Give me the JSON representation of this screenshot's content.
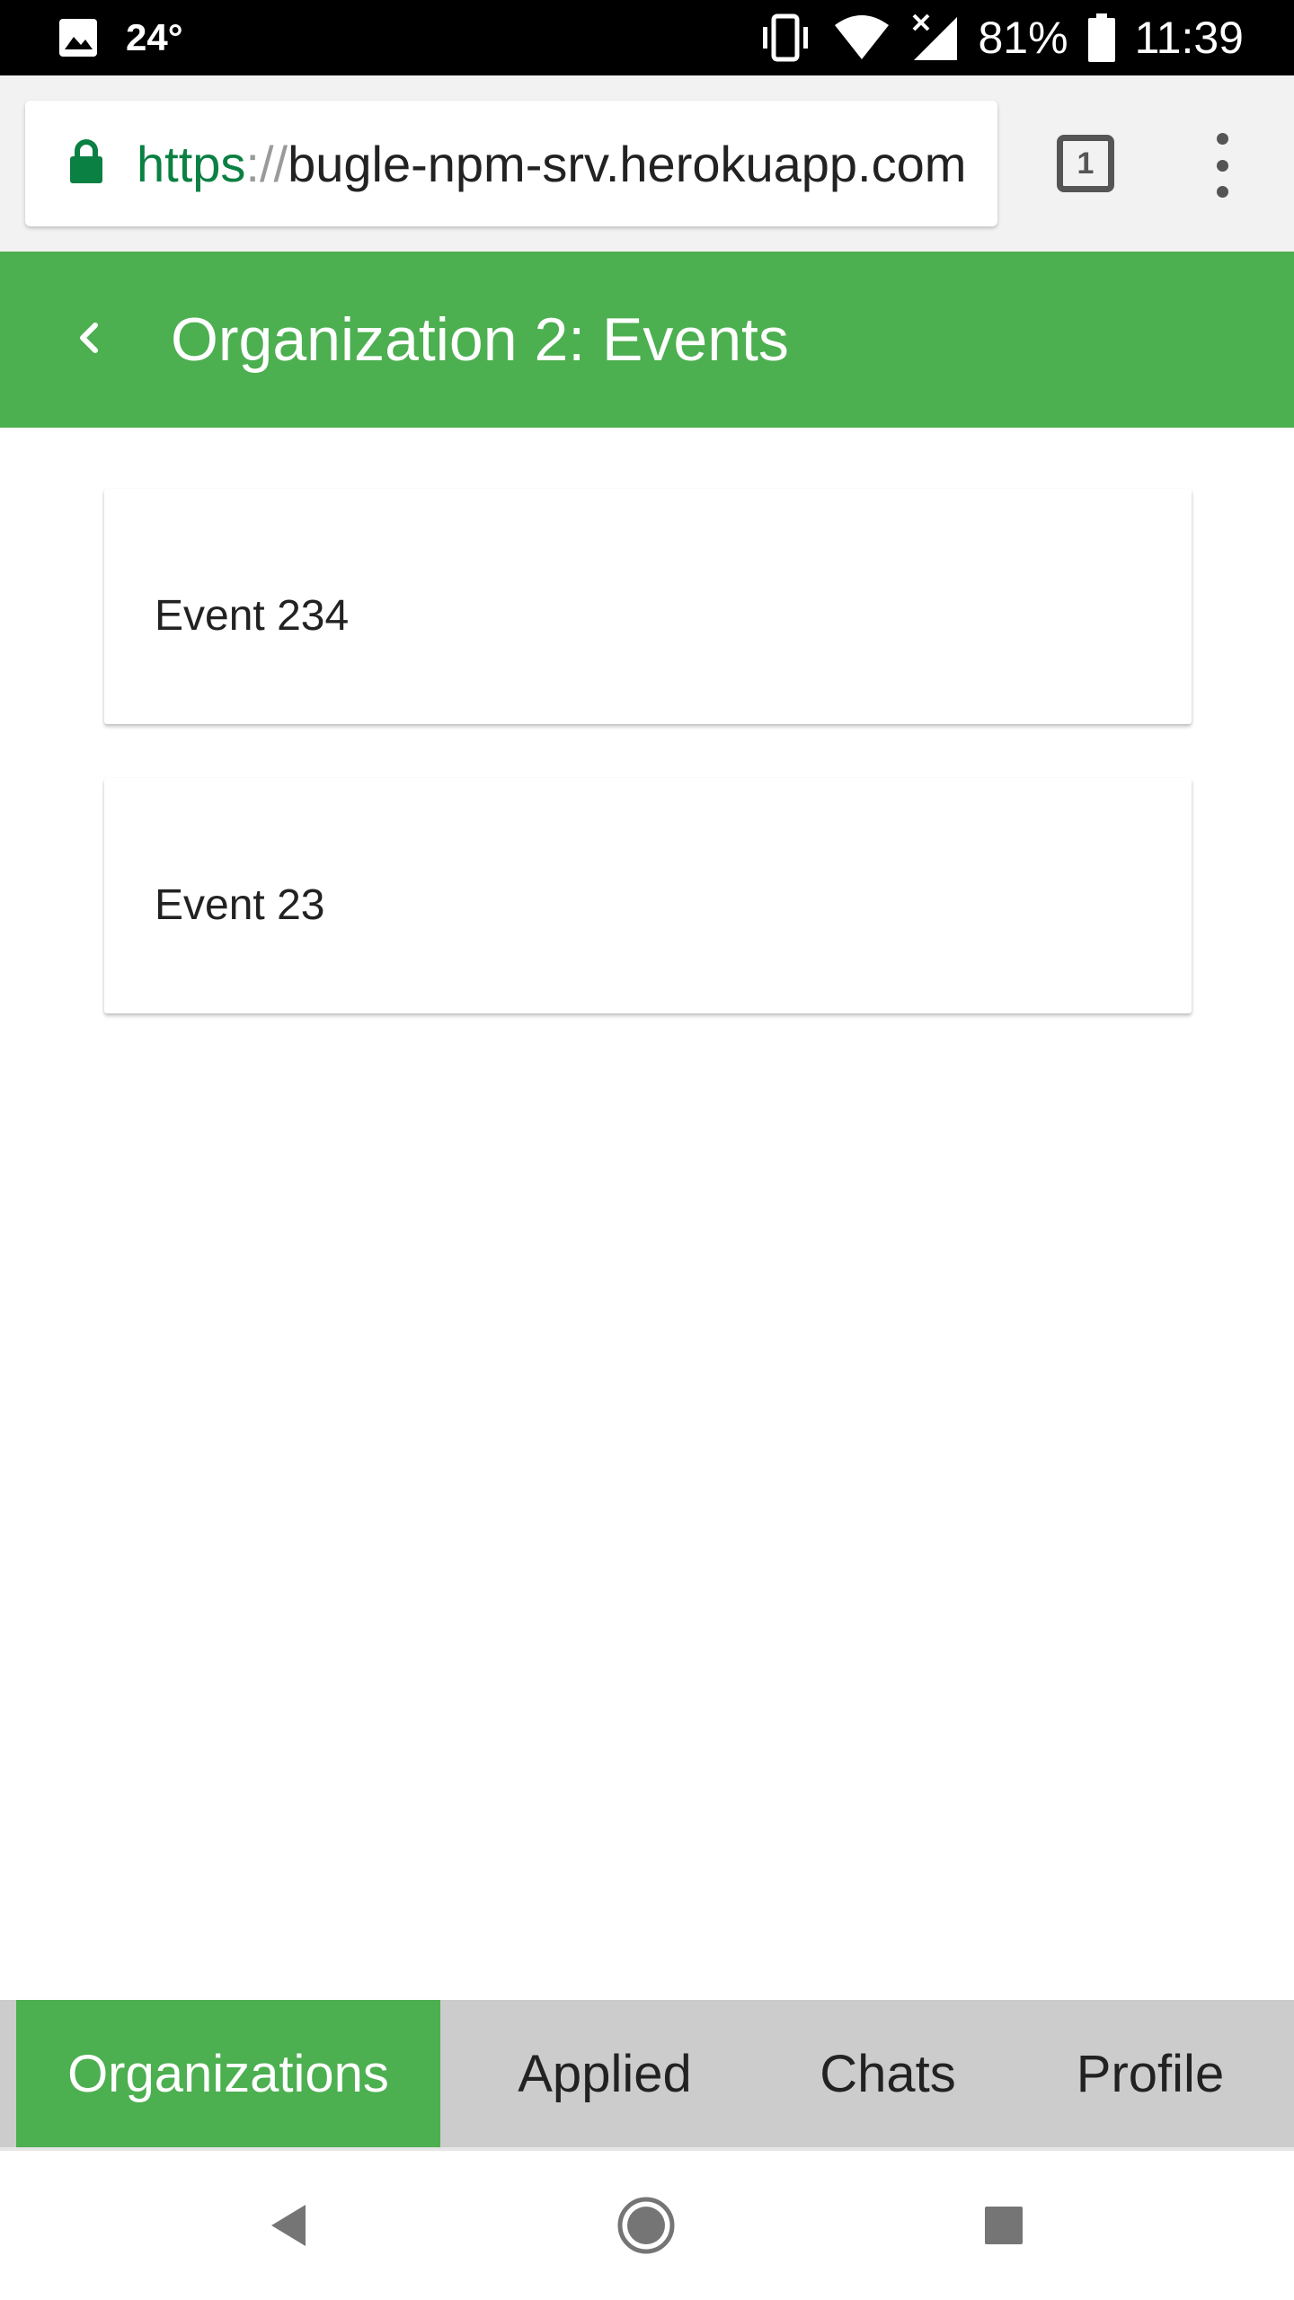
{
  "status_bar": {
    "temperature": "24°",
    "battery": "81%",
    "time": "11:39"
  },
  "browser": {
    "url_scheme": "https",
    "url_separator": "://",
    "url_host": "bugle-npm-srv.herokuapp.com",
    "tab_count": "1"
  },
  "header": {
    "title": "Organization 2: Events"
  },
  "events": [
    {
      "name": "Event 234"
    },
    {
      "name": "Event 23"
    }
  ],
  "tabs": [
    {
      "label": "Organizations",
      "active": true
    },
    {
      "label": "Applied",
      "active": false
    },
    {
      "label": "Chats",
      "active": false
    },
    {
      "label": "Profile",
      "active": false
    }
  ],
  "colors": {
    "primary": "#4caf50",
    "secure_green": "#0b8043",
    "tab_bar": "#cccccc"
  },
  "icons": {
    "status_left": "image-icon",
    "status_right": [
      "vibrate-icon",
      "wifi-icon",
      "cell-signal-icon",
      "battery-icon"
    ],
    "url": "lock-icon",
    "header": "chevron-left-icon",
    "nav": [
      "nav-back-icon",
      "nav-home-icon",
      "nav-recents-icon"
    ]
  }
}
